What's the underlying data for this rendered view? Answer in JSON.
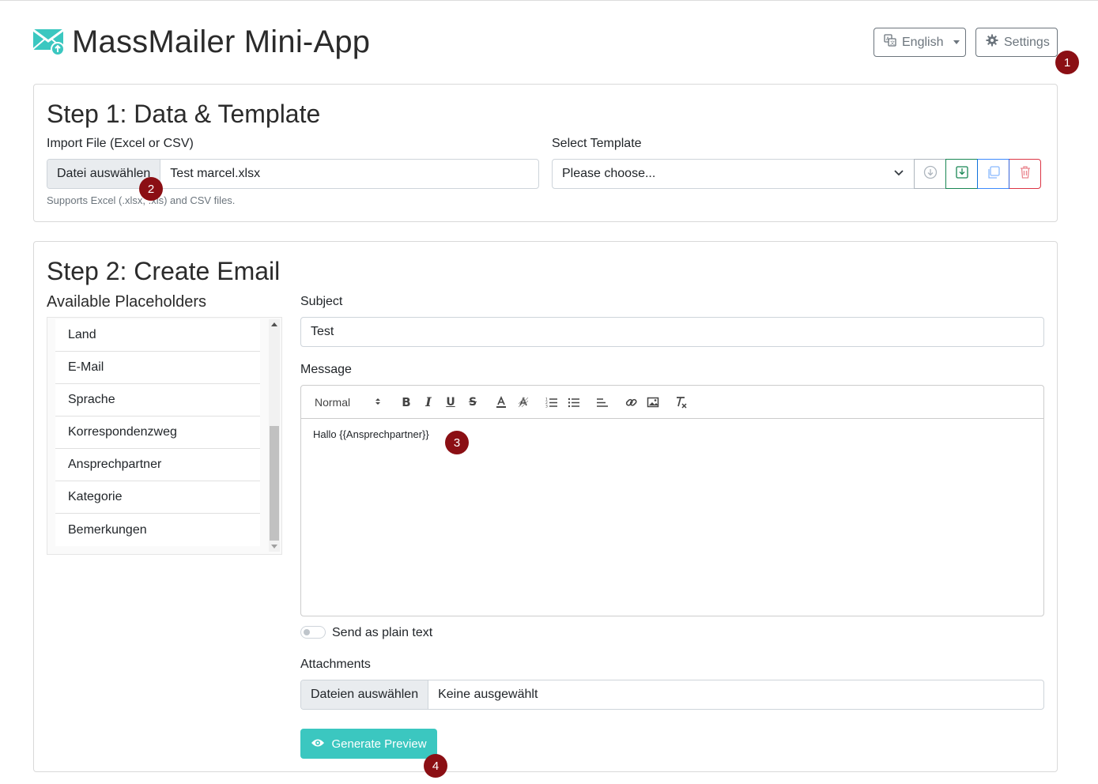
{
  "header": {
    "title": "MassMailer Mini-App",
    "language_label": "English",
    "settings_label": "Settings"
  },
  "step1": {
    "title": "Step 1: Data & Template",
    "import_label": "Import File (Excel or CSV)",
    "file_button": "Datei auswählen",
    "file_name": "Test marcel.xlsx",
    "help_text": "Supports Excel (.xlsx, .xls) and CSV files.",
    "template_label": "Select Template",
    "template_value": "Please choose..."
  },
  "step2": {
    "title": "Step 2: Create Email",
    "placeholders_title": "Available Placeholders",
    "placeholders": [
      "Land",
      "E-Mail",
      "Sprache",
      "Korrespondenzweg",
      "Ansprechpartner",
      "Kategorie",
      "Bemerkungen"
    ],
    "subject_label": "Subject",
    "subject_value": "Test",
    "message_label": "Message",
    "format_select": "Normal",
    "message_body": "Hallo {{Ansprechpartner}}",
    "plain_text_label": "Send as plain text",
    "attachments_label": "Attachments",
    "attachments_button": "Dateien auswählen",
    "attachments_value": "Keine ausgewählt",
    "preview_button": "Generate Preview"
  },
  "badges": [
    "1",
    "2",
    "3",
    "4"
  ],
  "colors": {
    "badge": "#8b0f14",
    "primary_button": "#3bc7c0",
    "logo": "#3bc7c0"
  }
}
